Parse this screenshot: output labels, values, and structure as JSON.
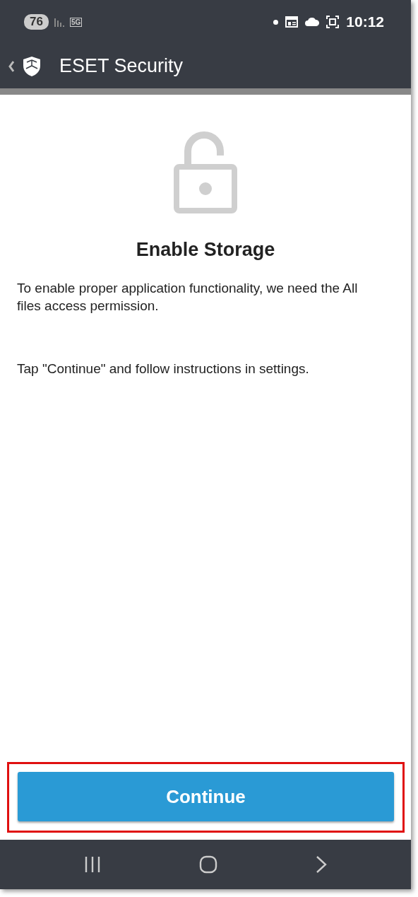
{
  "status_bar": {
    "battery": "76",
    "network": "5G",
    "time": "10:12"
  },
  "app_bar": {
    "title": "ESET Security"
  },
  "content": {
    "heading": "Enable Storage",
    "paragraphs": [
      "To enable proper application functionality, we need the All files access permission.",
      "Tap \"Continue\" and follow instructions in settings."
    ]
  },
  "button": {
    "label": "Continue",
    "highlighted": true
  }
}
